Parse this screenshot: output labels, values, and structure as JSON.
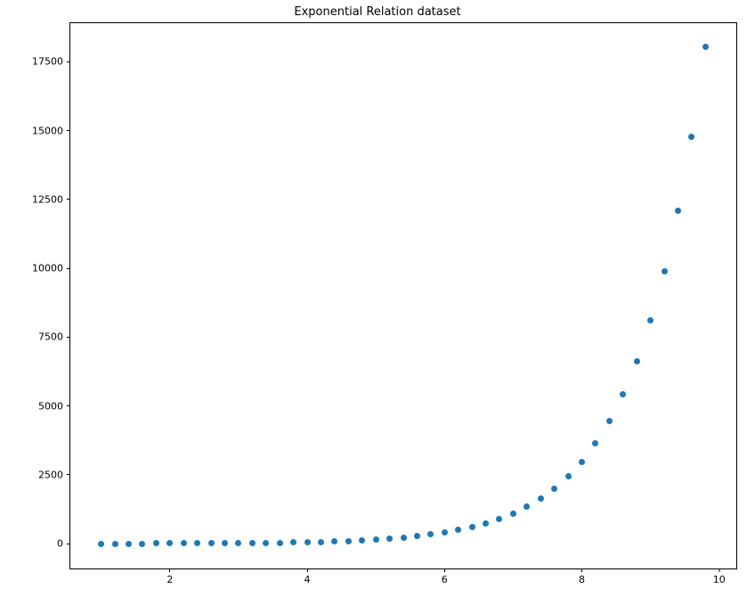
{
  "chart_data": {
    "type": "scatter",
    "title": "Exponential Relation dataset",
    "xlabel": "",
    "ylabel": "",
    "xlim": [
      0.55,
      10.25
    ],
    "ylim": [
      -900,
      18900
    ],
    "xticks": [
      2,
      4,
      6,
      8,
      10
    ],
    "yticks": [
      0,
      2500,
      5000,
      7500,
      10000,
      12500,
      15000,
      17500
    ],
    "marker_color": "#1f77b4",
    "x": [
      1.0,
      1.2,
      1.4,
      1.6,
      1.8,
      2.0,
      2.2,
      2.4,
      2.6,
      2.8,
      3.0,
      3.2,
      3.4,
      3.6,
      3.8,
      4.0,
      4.2,
      4.4,
      4.6,
      4.8,
      5.0,
      5.2,
      5.4,
      5.6,
      5.8,
      6.0,
      6.2,
      6.4,
      6.6,
      6.8,
      7.0,
      7.2,
      7.4,
      7.6,
      7.8,
      8.0,
      8.2,
      8.4,
      8.6,
      8.8,
      9.0,
      9.2,
      9.4,
      9.6,
      9.8
    ],
    "y": [
      2.72,
      3.32,
      4.06,
      4.95,
      6.05,
      7.39,
      9.03,
      11.02,
      13.46,
      16.44,
      20.09,
      24.53,
      29.96,
      36.6,
      44.7,
      54.6,
      66.69,
      81.45,
      99.48,
      121.51,
      148.41,
      181.27,
      221.41,
      270.43,
      330.3,
      403.43,
      492.75,
      601.85,
      735.1,
      897.85,
      1096.63,
      1339.43,
      1635.98,
      1998.2,
      2440.6,
      2980.96,
      3640.95,
      4447.07,
      5431.66,
      6634.24,
      8103.08,
      9897.13,
      12088.38,
      14764.78,
      18033.74
    ]
  }
}
